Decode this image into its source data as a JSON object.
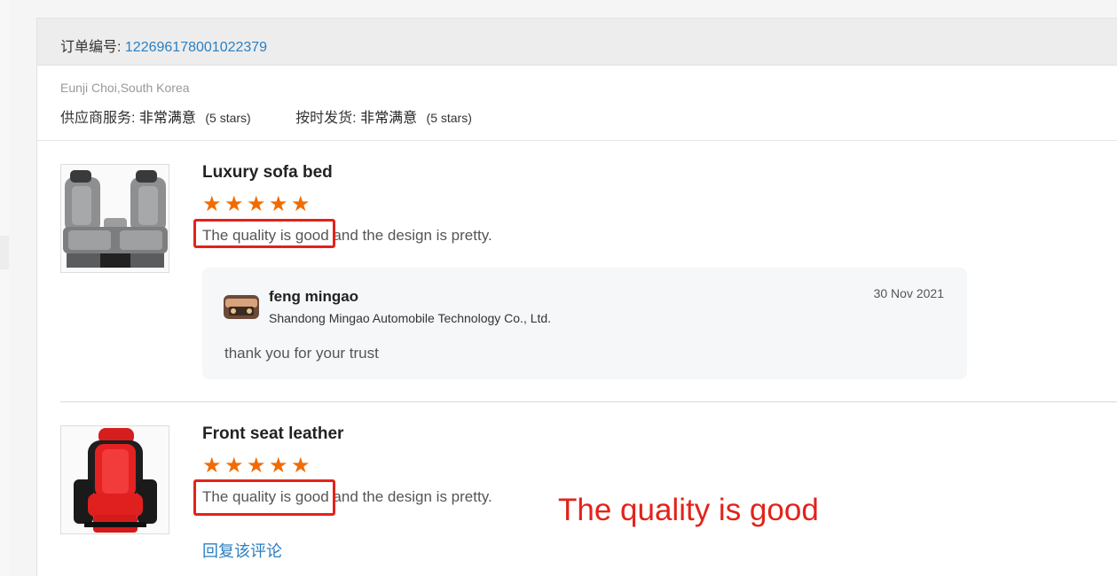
{
  "order": {
    "label": "订单编号:",
    "number": "122696178001022379"
  },
  "buyer": "Eunji Choi,South Korea",
  "ratings": [
    {
      "label": "供应商服务:",
      "value": "非常满意",
      "stars": "(5 stars)"
    },
    {
      "label": "按时发货:",
      "value": "非常满意",
      "stars": "(5 stars)"
    }
  ],
  "reviews": [
    {
      "product": "Luxury sofa bed",
      "rating": 5,
      "text_highlight": "The quality is good",
      "text_rest": " and the design is pretty.",
      "reply": {
        "name": "feng mingao",
        "company": "Shandong Mingao Automobile Technology Co., Ltd.",
        "date": "30 Nov 2021",
        "message": "thank you for your trust"
      }
    },
    {
      "product": "Front seat leather",
      "rating": 5,
      "text_highlight": "The quality is good",
      "text_rest": " and the design is pretty.",
      "reply_link": "回复该评论"
    }
  ],
  "annotation": "The quality is good",
  "colors": {
    "accent_link": "#2a7fc1",
    "star": "#f26b00",
    "highlight": "#e2231a"
  }
}
